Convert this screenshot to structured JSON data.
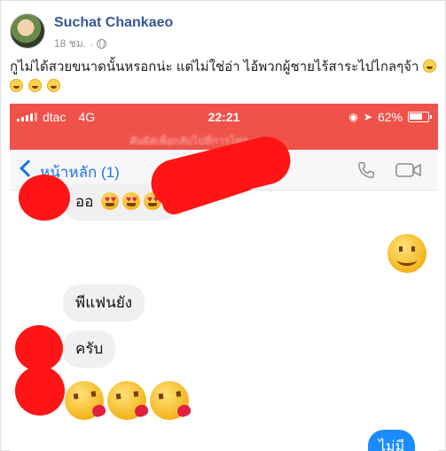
{
  "post": {
    "author": "Suchat Chankaeo",
    "time": "18 ชม.",
    "dot": "·",
    "text": "กูไม่ได้สวยขนาดนั้นหรอกน่ะ แต่ไม่ใช่อ่า ไอ้พวกผู้ชายไร้สาระไปไกลๆจ้า"
  },
  "screenshot": {
    "status": {
      "carrier": "dtac",
      "network": "4G",
      "time": "22:21",
      "battery": "62%"
    },
    "sub_bar_text": "สัมผัสเพื่อกลับไปที่การโทร...",
    "nav": {
      "back_label": "หน้าหลัก (1)"
    },
    "messages": {
      "first": "ออ",
      "question": "พีแฟนยัง",
      "answer": "ครับ",
      "reply": "ไม่มี"
    }
  },
  "colors": {
    "status_red": "#f0524a",
    "ios_blue": "#1a73e8",
    "bubble_out": "#1a8cff",
    "redaction": "#ff1515",
    "fb_link": "#365899"
  },
  "icons": [
    "globe-icon",
    "signal-icon",
    "battery-icon",
    "back-icon",
    "phone-icon",
    "video-icon",
    "grinning-emoji",
    "smile-emoji",
    "kiss-emoji",
    "heart-eyes-emoji"
  ]
}
